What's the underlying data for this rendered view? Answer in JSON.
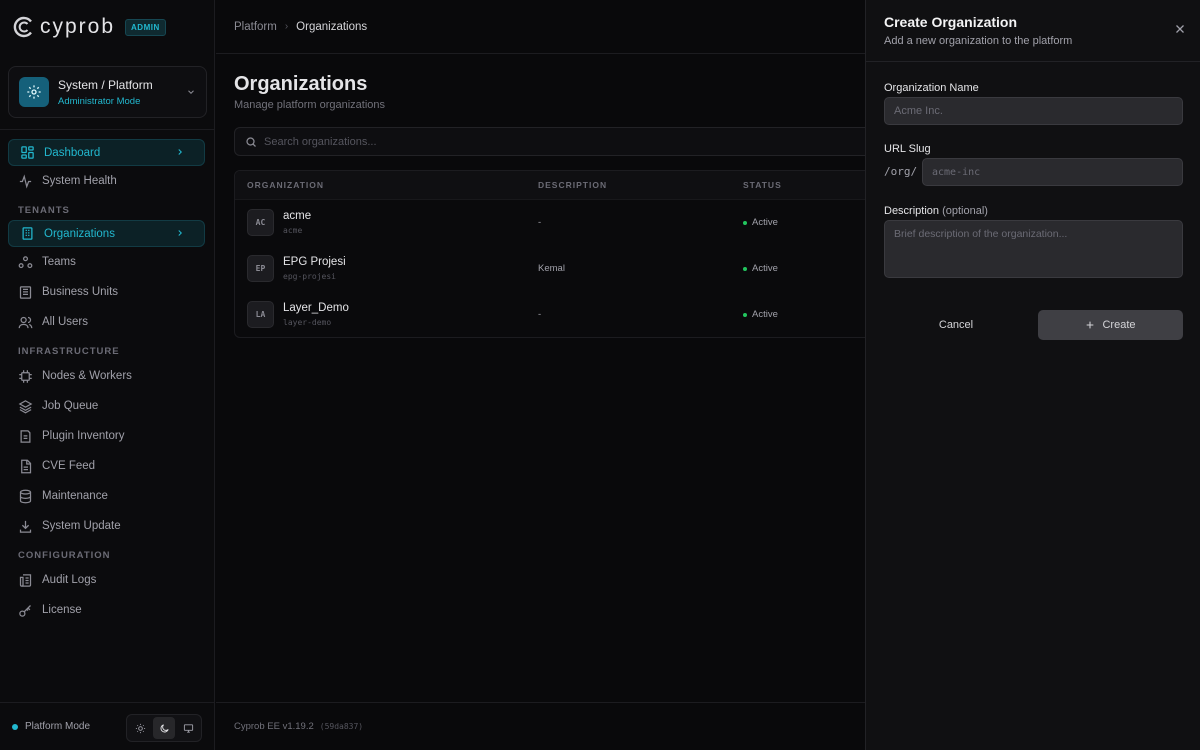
{
  "brand": {
    "name": "cyprob",
    "badge": "ADMIN",
    "accent": "#22b8cf"
  },
  "context": {
    "title": "System / Platform",
    "subtitle": "Administrator Mode"
  },
  "sidebar": {
    "items": [
      {
        "label": "Dashboard",
        "icon": "grid-icon"
      },
      {
        "label": "System Health",
        "icon": "activity-icon"
      }
    ],
    "section_tenants": "TENANTS",
    "tenants": [
      {
        "label": "Organizations",
        "icon": "building-icon"
      },
      {
        "label": "Teams",
        "icon": "users-icon"
      },
      {
        "label": "Business Units",
        "icon": "business-icon"
      },
      {
        "label": "All Users",
        "icon": "user-icon"
      }
    ],
    "section_infra": "INFRASTRUCTURE",
    "infra": [
      {
        "label": "Nodes & Workers",
        "icon": "cpu-icon"
      },
      {
        "label": "Job Queue",
        "icon": "layers-icon"
      },
      {
        "label": "Plugin Inventory",
        "icon": "inventory-icon"
      },
      {
        "label": "CVE Feed",
        "icon": "file-icon"
      },
      {
        "label": "Maintenance",
        "icon": "database-icon"
      },
      {
        "label": "System Update",
        "icon": "download-icon"
      }
    ],
    "section_config": "CONFIGURATION",
    "config": [
      {
        "label": "Audit Logs",
        "icon": "logs-icon"
      },
      {
        "label": "License",
        "icon": "key-icon"
      }
    ],
    "footer_mode": "Platform Mode"
  },
  "breadcrumb": {
    "parent": "Platform",
    "current": "Organizations"
  },
  "page": {
    "title": "Organizations",
    "subtitle": "Manage platform organizations"
  },
  "search": {
    "placeholder": "Search organizations..."
  },
  "table": {
    "columns": {
      "org": "ORGANIZATION",
      "desc": "DESCRIPTION",
      "status": "STATUS"
    },
    "rows": [
      {
        "initials": "AC",
        "name": "acme",
        "slug": "acme",
        "description": "-",
        "status": "Active"
      },
      {
        "initials": "EP",
        "name": "EPG Projesi",
        "slug": "epg-projesi",
        "description": "Kemal",
        "status": "Active"
      },
      {
        "initials": "LA",
        "name": "Layer_Demo",
        "slug": "layer-demo",
        "description": "-",
        "status": "Active"
      }
    ]
  },
  "footer": {
    "version": "Cyprob EE v1.19.2",
    "commit": "(59da837)"
  },
  "dialog": {
    "title": "Create Organization",
    "subtitle": "Add a new organization to the platform",
    "name_label": "Organization Name",
    "name_placeholder": "Acme Inc.",
    "name_value": "",
    "slug_label": "URL Slug",
    "slug_prefix": "/org/",
    "slug_placeholder": "acme-inc",
    "slug_value": "",
    "desc_label": "Description",
    "desc_optional": "(optional)",
    "desc_placeholder": "Brief description of the organization...",
    "desc_value": "",
    "cancel_label": "Cancel",
    "create_label": "Create"
  }
}
